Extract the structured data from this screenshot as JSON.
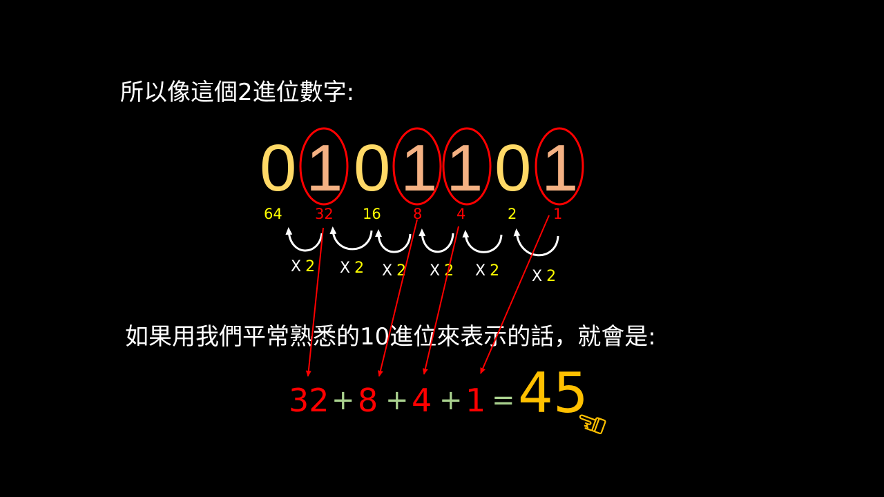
{
  "slide": {
    "title": "所以像這個2進位數字:",
    "subtitle": "如果用我們平常熟悉的10進位來表示的話，就會是:"
  },
  "binary": {
    "digits": [
      "0",
      "1",
      "0",
      "1",
      "1",
      "0",
      "1"
    ],
    "circled": [
      false,
      true,
      false,
      true,
      true,
      false,
      true
    ]
  },
  "weights": [
    "64",
    "32",
    "16",
    "8",
    "4",
    "2",
    "1"
  ],
  "multiplier": {
    "x": "X",
    "factor": "2"
  },
  "equation": {
    "terms": [
      "32",
      "8",
      "4",
      "1"
    ],
    "plus": "+",
    "equals": "=",
    "result": "45"
  },
  "colors": {
    "zero_digit": "#ffd966",
    "one_digit": "#f4b183",
    "circle": "#ff0000",
    "weight_plain": "#ffff00",
    "weight_active": "#ff0000",
    "arrow_red": "#ff0000",
    "operator": "#a9d18e",
    "result": "#ffc000",
    "pointer_icon": "#ffc000"
  },
  "icons": {
    "pointer": "pointing-hand-icon"
  }
}
